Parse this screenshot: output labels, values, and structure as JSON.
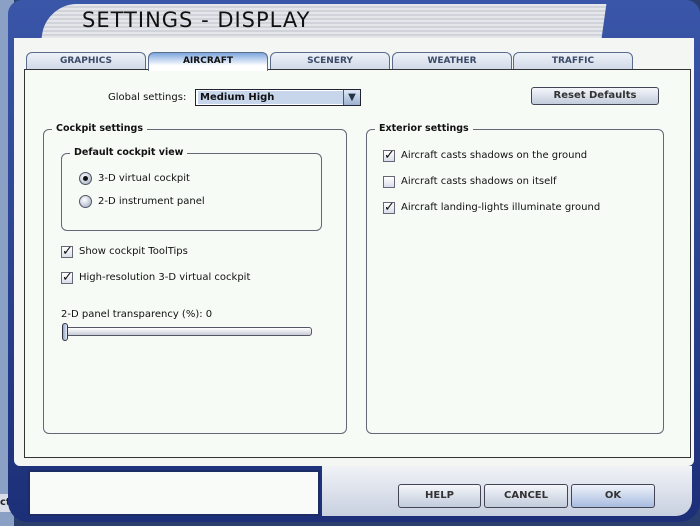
{
  "window": {
    "title": "SETTINGS - DISPLAY",
    "background_fragment": "cts"
  },
  "tabs": [
    {
      "label": "GRAPHICS"
    },
    {
      "label": "AIRCRAFT"
    },
    {
      "label": "SCENERY"
    },
    {
      "label": "WEATHER"
    },
    {
      "label": "TRAFFIC"
    }
  ],
  "active_tab": "AIRCRAFT",
  "global": {
    "label": "Global settings:",
    "value": "Medium High",
    "reset_label": "Reset Defaults"
  },
  "cockpit": {
    "title": "Cockpit settings",
    "view_title": "Default cockpit view",
    "radios": [
      {
        "label": "3-D virtual cockpit",
        "selected": true
      },
      {
        "label": "2-D instrument panel",
        "selected": false
      }
    ],
    "checks": [
      {
        "label": "Show cockpit ToolTips",
        "checked": true
      },
      {
        "label": "High-resolution 3-D virtual cockpit",
        "checked": true
      }
    ],
    "transparency_label": "2-D panel transparency (%): 0",
    "transparency_value": 0
  },
  "exterior": {
    "title": "Exterior settings",
    "checks": [
      {
        "label": "Aircraft casts shadows on the ground",
        "checked": true
      },
      {
        "label": "Aircraft casts shadows on itself",
        "checked": false
      },
      {
        "label": "Aircraft landing-lights illuminate ground",
        "checked": true
      }
    ]
  },
  "buttons": {
    "help": "HELP",
    "cancel": "CANCEL",
    "ok": "OK"
  }
}
